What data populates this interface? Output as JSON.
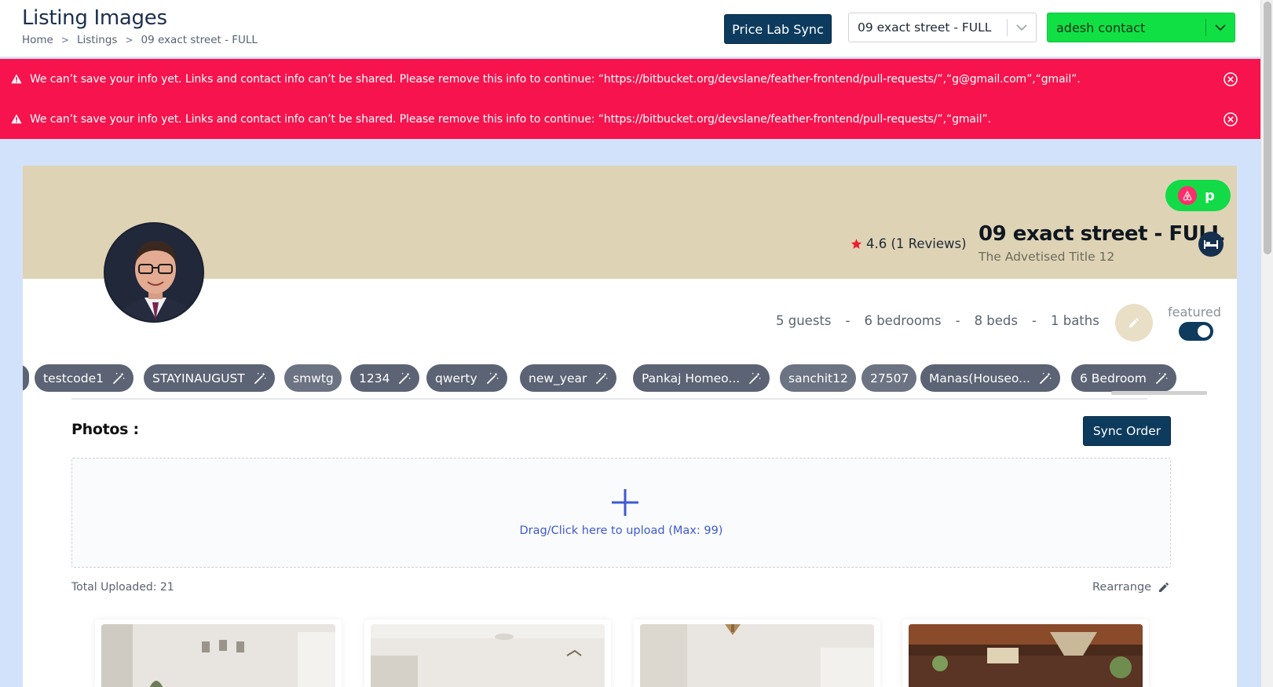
{
  "header": {
    "title": "Listing Images",
    "breadcrumb": [
      "Home",
      "Listings",
      "09 exact street - FULL"
    ],
    "price_lab_button": "Price Lab Sync",
    "listing_select": "09 exact street - FULL",
    "contact_select": "adesh contact"
  },
  "alerts": [
    "We can’t save your info yet. Links and contact info can’t be shared. Please remove this info to continue: “https://bitbucket.org/devslane/feather-frontend/pull-requests/”,“g@gmail.com”,“gmail”.",
    "We can’t save your info yet. Links and contact info can’t be shared. Please remove this info to continue: “https://bitbucket.org/devslane/feather-frontend/pull-requests/”,“gmail”."
  ],
  "listing": {
    "platform_initial": "p",
    "rating": "4.6 (1 Reviews)",
    "name": "09 exact street - FULL",
    "advertised_title": "The Advetised Title 12",
    "stats": [
      "5 guests",
      "6 bedrooms",
      "8 beds",
      "1 baths"
    ],
    "stat_separator": "-",
    "featured_label": "featured",
    "featured_on": true
  },
  "tags": [
    {
      "label": "testcode1",
      "has_wand": true
    },
    {
      "label": "STAYINAUGUST",
      "has_wand": true
    },
    {
      "label": "smwtg",
      "has_wand": false
    },
    {
      "label": "1234",
      "has_wand": true
    },
    {
      "label": "qwerty",
      "has_wand": true
    },
    {
      "label": "new_year",
      "has_wand": true
    },
    {
      "label": "Pankaj Homeo...",
      "has_wand": true
    },
    {
      "label": "sanchit12",
      "has_wand": false
    },
    {
      "label": "27507",
      "has_wand": false
    },
    {
      "label": "Manas(Houseo...",
      "has_wand": true
    },
    {
      "label": "6 Bedroom",
      "has_wand": true
    }
  ],
  "photos": {
    "title": "Photos :",
    "sync_button": "Sync Order",
    "upload_text": "Drag/Click here to upload (Max: 99)",
    "total_uploaded": "Total Uploaded: 21",
    "rearrange_label": "Rearrange"
  },
  "colors": {
    "alert": "#f7134d",
    "primary_button": "#0d3b5e",
    "contact_green": "#11e045",
    "cover": "#dfd3b5"
  },
  "icons": {
    "alert": "warning-triangle-icon",
    "close": "close-circle-icon",
    "tag_action": "magic-wand-icon",
    "edit": "pencil-icon",
    "property_type": "bed-icon",
    "rating": "star-icon",
    "upload": "plus-icon"
  }
}
